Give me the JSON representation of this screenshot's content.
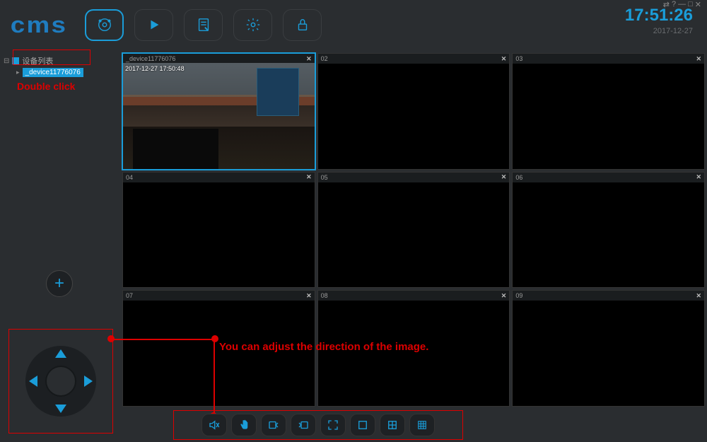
{
  "app": {
    "logo": "cms"
  },
  "clock": {
    "time": "17:51:26",
    "date": "2017-12-27"
  },
  "tree": {
    "root": "设备列表",
    "device": "_device11776076"
  },
  "annotations": {
    "double_click": "Double click",
    "direction": "You can adjust the direction of the image."
  },
  "cells": [
    {
      "label": "_device11776076",
      "overlay": "2017-12-27  17:50:48",
      "active": true,
      "feed": true
    },
    {
      "label": "02"
    },
    {
      "label": "03"
    },
    {
      "label": "04"
    },
    {
      "label": "05"
    },
    {
      "label": "06"
    },
    {
      "label": "07"
    },
    {
      "label": "08"
    },
    {
      "label": "09"
    }
  ],
  "icons": {
    "close": "✕",
    "add": "+"
  }
}
